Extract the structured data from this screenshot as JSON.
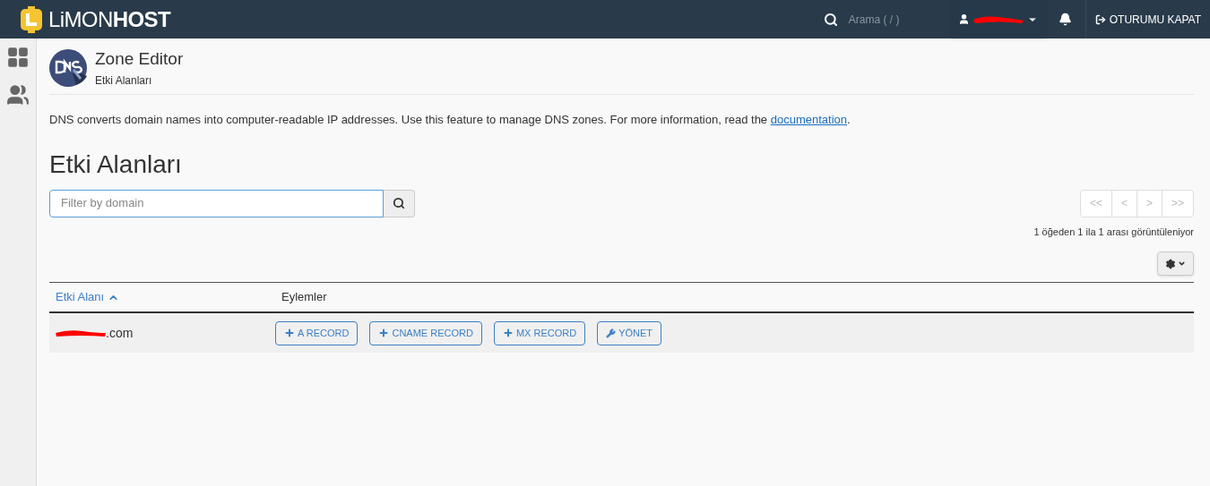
{
  "header": {
    "logo_light": "LiMON",
    "logo_bold": "HOST",
    "search": {
      "placeholder": "Arama ( / )"
    },
    "logout": "OTURUMU KAPAT"
  },
  "page": {
    "title": "Zone Editor",
    "subtitle": "Etki Alanları",
    "description": "DNS converts domain names into computer-readable IP addresses. Use this feature to manage DNS zones. For more information, read the ",
    "link": "documentation",
    "description_end": ".",
    "heading": "Etki Alanları"
  },
  "filter": {
    "placeholder": "Filter by domain"
  },
  "pagination": {
    "buttons": [
      "<<",
      "<",
      ">",
      ">>"
    ],
    "summary": "1 öğeden 1 ila 1 arası görüntüleniyor"
  },
  "table": {
    "columns": [
      {
        "label": "Etki Alanı",
        "sorted": true
      },
      {
        "label": "Eylemler",
        "sorted": false
      }
    ],
    "rows": [
      {
        "domain": ".com",
        "actions": [
          {
            "kind": "add",
            "label": "A RECORD"
          },
          {
            "kind": "add",
            "label": "CNAME RECORD"
          },
          {
            "kind": "add",
            "label": "MX RECORD"
          },
          {
            "kind": "manage",
            "label": "YÖNET"
          }
        ]
      }
    ]
  }
}
